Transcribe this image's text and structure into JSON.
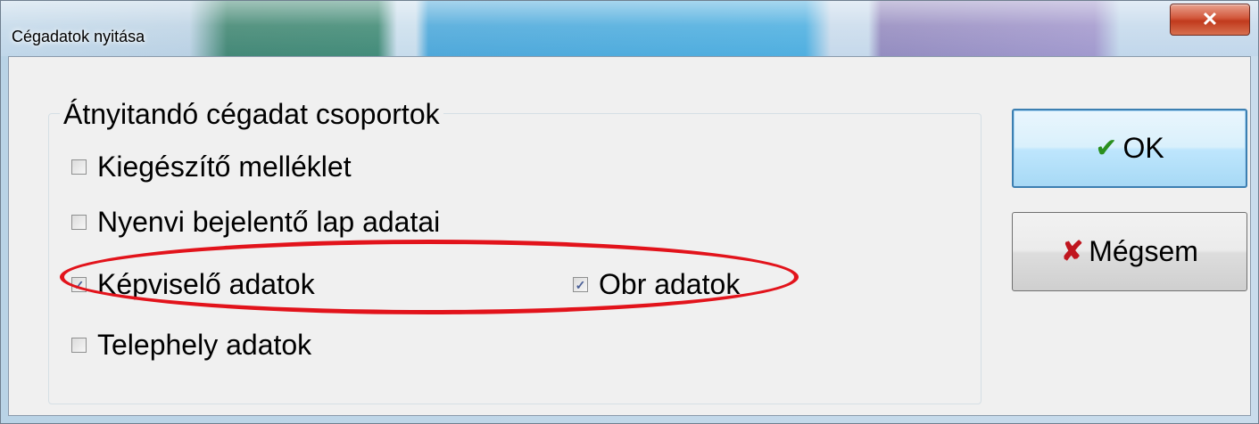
{
  "window": {
    "title": "Cégadatok nyitása",
    "close_symbol": "✕"
  },
  "group": {
    "title": "Átnyitandó cégadat csoportok",
    "checkboxes": [
      {
        "label": "Kiegészítő melléklet",
        "checked": false
      },
      {
        "label": "Nyenvi bejelentő lap adatai",
        "checked": false
      },
      {
        "label": "Képviselő adatok",
        "checked": true
      },
      {
        "label": "Obr adatok",
        "checked": true
      },
      {
        "label": "Telephely adatok",
        "checked": false
      }
    ]
  },
  "buttons": {
    "ok_label": "OK",
    "ok_icon": "check-icon",
    "cancel_label": "Mégsem",
    "cancel_icon": "x-icon"
  },
  "annotation": {
    "highlight_color": "#e2131b"
  }
}
